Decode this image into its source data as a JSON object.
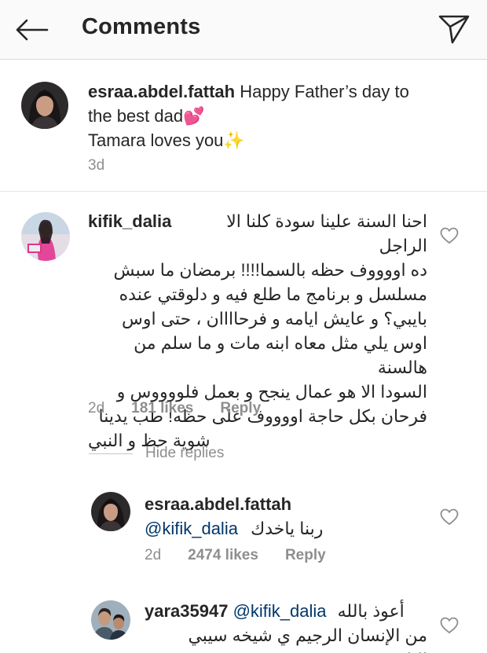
{
  "header": {
    "title": "Comments",
    "back_icon": "back-arrow-icon",
    "share_icon": "direct-share-icon"
  },
  "caption": {
    "username": "esraa.abdel.fattah",
    "line1": "Happy Father’s day to",
    "line2": "the best dad💕",
    "line3": "Tamara loves you✨",
    "time": "3d"
  },
  "comments": [
    {
      "username": "kifik_dalia",
      "lines": [
        "احنا السنة علينا سودة كلنا الا الراجل",
        "ده اووووف حظه بالسما!!!! برمضان ما سبش",
        "مسلسل و برنامج ما طلع فيه و دلوقتي عنده",
        "بايبي؟ و عايش ايامه و فرحاااان ، حتى اوس",
        "اوس يلي مثل معاه ابنه مات و ما سلم من هالسنة",
        "السودا الا هو عمال ينجح و بعمل فلووووس و",
        "فرحان بكل حاجة اووووف على حظه! طب يدينا",
        "شوية حظ و النبي"
      ],
      "time": "2d",
      "likes": "181 likes",
      "reply": "Reply"
    }
  ],
  "hide_replies": "Hide replies",
  "replies": [
    {
      "username": "esraa.abdel.fattah",
      "mention": "@kifik_dalia",
      "text": "ربنا ياخدك",
      "time": "2d",
      "likes": "2474 likes",
      "reply": "Reply"
    },
    {
      "username": "yara35947",
      "mention": "@kifik_dalia",
      "text1": "أعوذ بالله",
      "text2": "من الإنسان الرجيم ي شيخه سيبي الناس"
    }
  ],
  "colors": {
    "text": "#262626",
    "meta": "#8e8e8e",
    "mention": "#00376b",
    "header_bg": "#fafafa",
    "divider": "#dbdbdb"
  }
}
